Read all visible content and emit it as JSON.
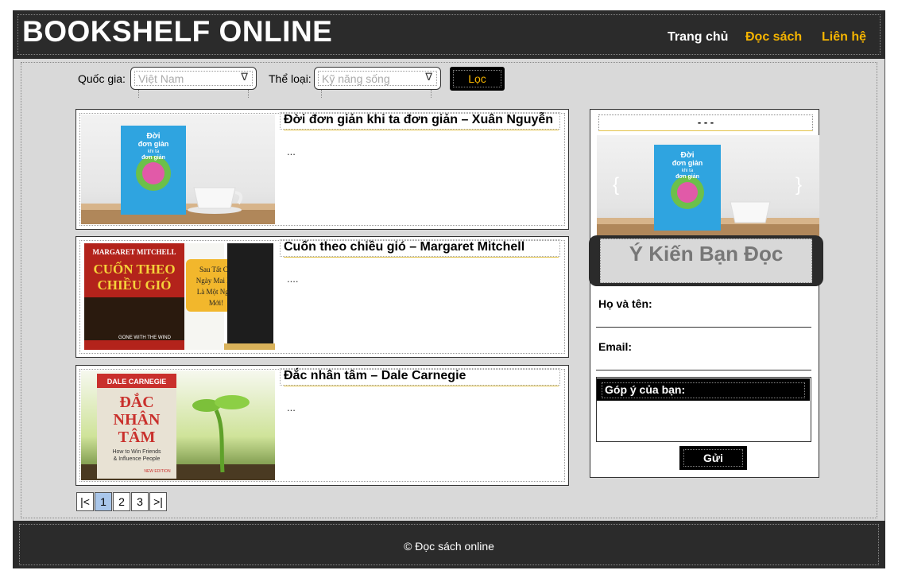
{
  "header": {
    "logo": "BOOKSHELF ONLINE",
    "nav": [
      "Trang chủ",
      "Đọc sách",
      "Liên hệ"
    ]
  },
  "filters": {
    "country_label": "Quốc gia:",
    "country_value": "Việt Nam",
    "genre_label": "Thể loại:",
    "genre_value": "Kỹ năng sống",
    "filter_button": "Lọc"
  },
  "books": [
    {
      "title": "Đời đơn giản khi ta đơn giản – Xuân Nguyễn",
      "desc": "...",
      "cover_lines": [
        "Đời",
        "đơn giản",
        "khi ta",
        "đơn giản"
      ]
    },
    {
      "title": "Cuốn theo chiều gió – Margaret Mitchell",
      "desc": "....",
      "cover_lines": [
        "MARGARET MITCHELL",
        "CUỐN THEO",
        "CHIỀU GIÓ",
        "GONE WITH THE WIND",
        "Sau Tất Cả,",
        "Ngày Mai Lại",
        "Là Một Ngày",
        "Mới!"
      ]
    },
    {
      "title": "Đắc nhân tâm – Dale Carnegie",
      "desc": "...",
      "cover_lines": [
        "DALE CARNEGIE",
        "ĐẮC",
        "NHÂN",
        "TÂM",
        "How to Win Friends",
        "& Influence People",
        "NEW EDITION"
      ]
    }
  ],
  "pagination": [
    "|<",
    "1",
    "2",
    "3",
    ">|"
  ],
  "sidebar": {
    "slider_label": "- - -",
    "slider_prev": "{",
    "slider_next": "}",
    "feedback_title": "Ý Kiến Bạn Đọc",
    "name_label": "Họ và tên:",
    "email_label": "Email:",
    "comment_label": "Góp ý của bạn:",
    "send_button": "Gửi"
  },
  "footer": {
    "text": "© Đọc sách online"
  },
  "colors": {
    "dark": "#2b2b2b",
    "accent": "#f5b400",
    "background": "#d9d9d9"
  }
}
